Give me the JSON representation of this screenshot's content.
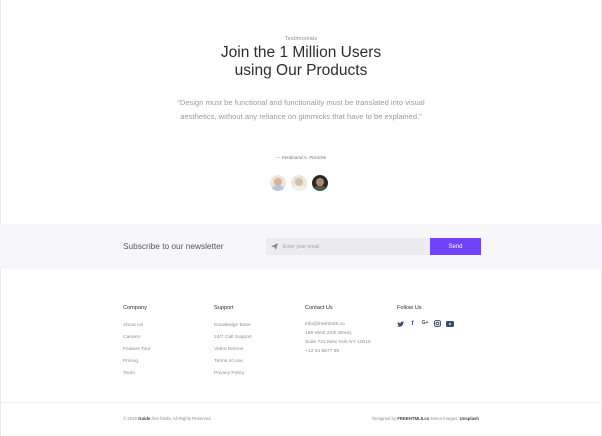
{
  "testimonials": {
    "eyebrow": "Testimonials",
    "title_line1": "Join the 1 Million Users",
    "title_line2": "using Our Products",
    "quote": "“Design must be functional and functionality must be translated into visual aesthetics, without any reliance on gimmicks that have to be explained.”",
    "author": "— Ferdinand A. Porsche",
    "avatars": [
      "avatar-1",
      "avatar-2",
      "avatar-3"
    ]
  },
  "newsletter": {
    "label": "Subscribe to our newsletter",
    "placeholder": "Enter your email",
    "send_label": "Send",
    "accent": "#7044ff"
  },
  "footer": {
    "company": {
      "title": "Company",
      "links": [
        "About Us",
        "Careers",
        "Feature Tour",
        "Pricing",
        "Team"
      ]
    },
    "support": {
      "title": "Support",
      "links": [
        "Knowledge Base",
        "24/7 Call Support",
        "Video Demos",
        "Terms of Use",
        "Privacy Policy"
      ]
    },
    "contact": {
      "title": "Contact Us",
      "email": "info@freehtml5.co",
      "address_line1": "198 West 21th Street,",
      "address_line2": "Suite 721 New York NY 10016",
      "phone": "+12 34 5677 89"
    },
    "follow": {
      "title": "Follow Us",
      "icons": [
        "twitter-icon",
        "facebook-icon",
        "google-plus-icon",
        "instagram-icon",
        "youtube-icon"
      ]
    },
    "copyright_prefix": "© 2016",
    "copyright_brand": "Guide",
    "copyright_suffix": "free html5. All Rights Reserved.",
    "designed_by_prefix": "Designed by",
    "designed_by_brand": "FREEHTML5.co",
    "demo_images_prefix": "Demo Images:",
    "demo_images_brand": "Unsplash"
  }
}
